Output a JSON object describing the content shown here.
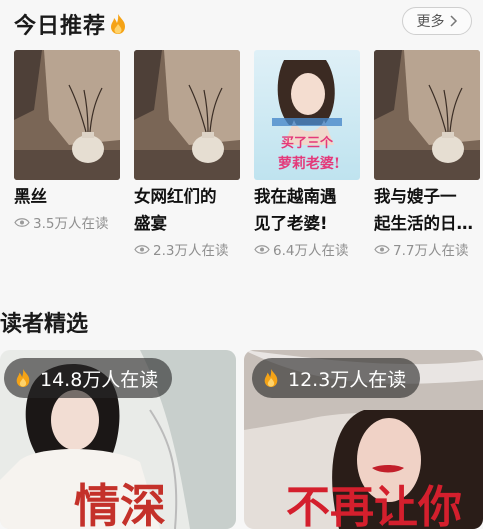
{
  "section1": {
    "title": "今日推荐",
    "more_label": "更多",
    "books": [
      {
        "title": "黑丝",
        "reads": "3.5万人在读"
      },
      {
        "title": "女网红们的\n盛宴",
        "reads": "2.3万人在读"
      },
      {
        "title": "我在越南遇\n见了老婆!",
        "reads": "6.4万人在读"
      },
      {
        "title": "我与嫂子一\n起生活的日…",
        "reads": "7.7万人在读"
      }
    ]
  },
  "section2": {
    "title": "读者精选",
    "cards": [
      {
        "reads": "14.8万人在读",
        "cover_text": "情深"
      },
      {
        "reads": "12.3万人在读",
        "cover_text": "不再让你"
      }
    ]
  },
  "cover3": {
    "line1": "买了三个",
    "line2": "萝莉老婆!"
  },
  "colors": {
    "accent": "#f5a316",
    "text_muted": "#8f8f8f",
    "pill_bg": "#3a3a3a"
  },
  "icons": [
    "flame-icon",
    "chevron-right-icon",
    "eye-icon"
  ]
}
